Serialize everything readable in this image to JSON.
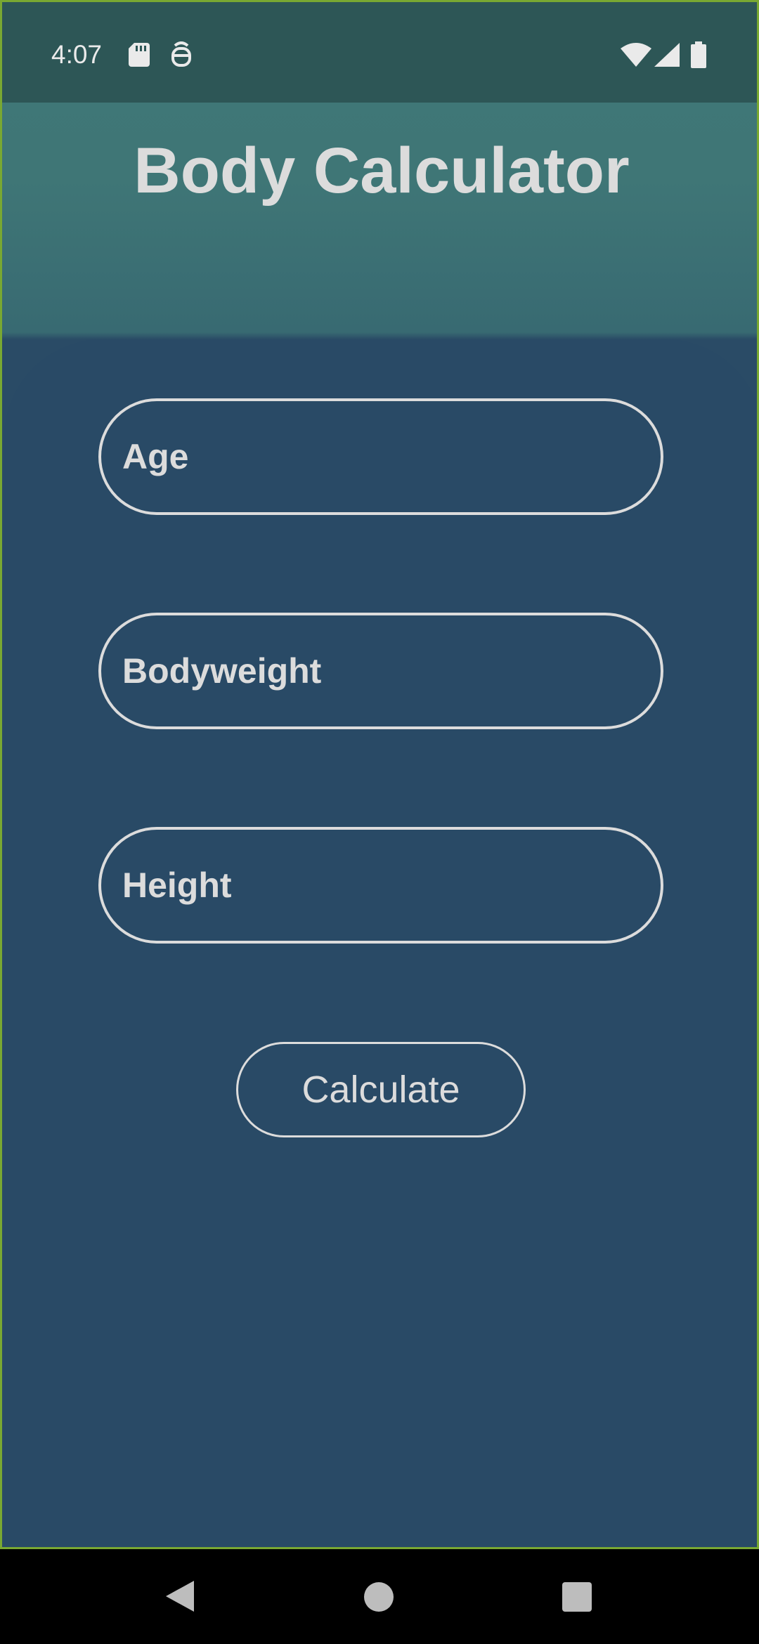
{
  "status_bar": {
    "time": "4:07",
    "icons": [
      "sd-card-icon",
      "face-icon",
      "wifi-icon",
      "signal-icon",
      "battery-icon"
    ]
  },
  "app": {
    "title": "Body Calculator"
  },
  "form": {
    "age_placeholder": "Age",
    "bodyweight_placeholder": "Bodyweight",
    "height_placeholder": "Height",
    "calculate_label": "Calculate"
  },
  "nav_bar": {
    "icons": [
      "back-icon",
      "home-icon",
      "recents-icon"
    ]
  },
  "colors": {
    "header_bg": "#3f7676",
    "card_bg": "#294a66",
    "text": "#dcdcdc",
    "status_bar_bg": "#2d5656"
  }
}
